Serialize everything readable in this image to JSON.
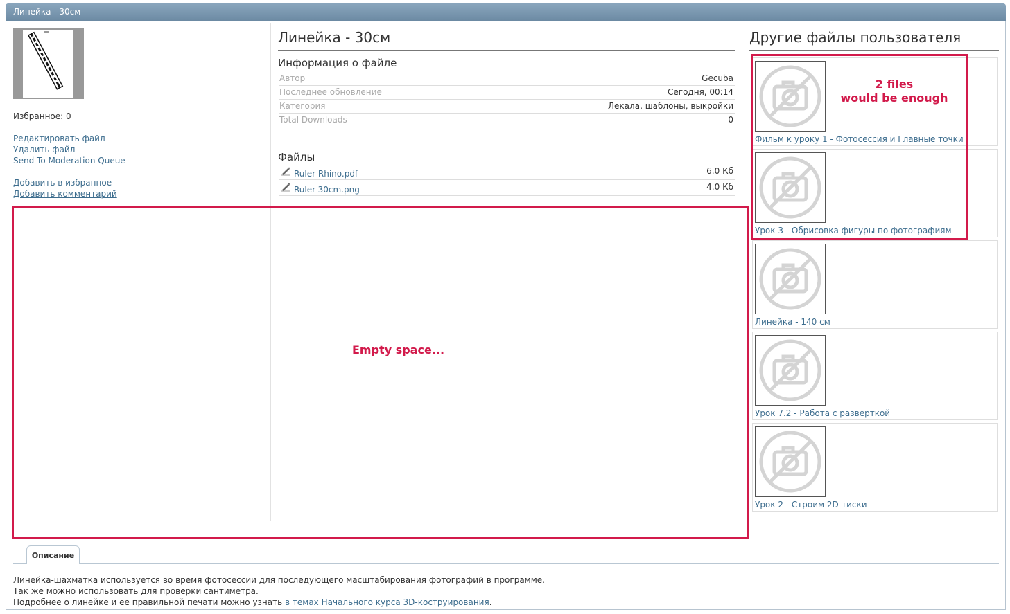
{
  "window": {
    "title": "Линейка - 30см"
  },
  "left": {
    "favorites": "Избранное: 0",
    "edit_file": "Редактировать файл",
    "delete_file": "Удалить файл",
    "send_moderation": "Send To Moderation Queue",
    "add_favorite": "Добавить в избранное",
    "add_comment": "Добавить комментарий"
  },
  "main": {
    "title": "Линейка - 30см",
    "info_heading": "Информация о файле",
    "info_rows": [
      {
        "label": "Автор",
        "value": "Gecuba"
      },
      {
        "label": "Последнее обновление",
        "value": "Сегодня, 00:14"
      },
      {
        "label": "Категория",
        "value": "Лекала, шаблоны, выкройки"
      },
      {
        "label": "Total Downloads",
        "value": "0"
      }
    ],
    "files_heading": "Файлы",
    "files": [
      {
        "name": "Ruler Rhino.pdf",
        "size": "6.0 Кб"
      },
      {
        "name": "Ruler-30cm.png",
        "size": "4.0 Кб"
      }
    ]
  },
  "right": {
    "title": "Другие файлы пользователя",
    "items": [
      {
        "caption": "Фильм к уроку 1 - Фотосессия и Главные точки"
      },
      {
        "caption": "Урок 3 - Обрисовка фигуры по фотографиям"
      },
      {
        "caption": "Линейка - 140 см"
      },
      {
        "caption": "Урок 7.2 - Работа с разверткой"
      },
      {
        "caption": "Урок 2 - Строим 2D-тиски"
      }
    ]
  },
  "annotations": {
    "files_note_1": "2 files",
    "files_note_2": "would be enough",
    "empty_note": "Empty space..."
  },
  "tabs": {
    "description": "Описание"
  },
  "description": {
    "line1": "Линейка-шахматка используется во время фотосессии для последующего масштабирования фотографий в программе.",
    "line2": "Так же можно использовать для проверки сантиметра.",
    "line3_prefix": "Подробнее о линейке и ее правильной печати можно узнать ",
    "line3_link": "в темах Начального курса 3D-коструирования",
    "line3_suffix": "."
  },
  "colors": {
    "annotation": "#d21a4b",
    "link": "#3d6d8e",
    "titlebar": "#7a96ad"
  }
}
